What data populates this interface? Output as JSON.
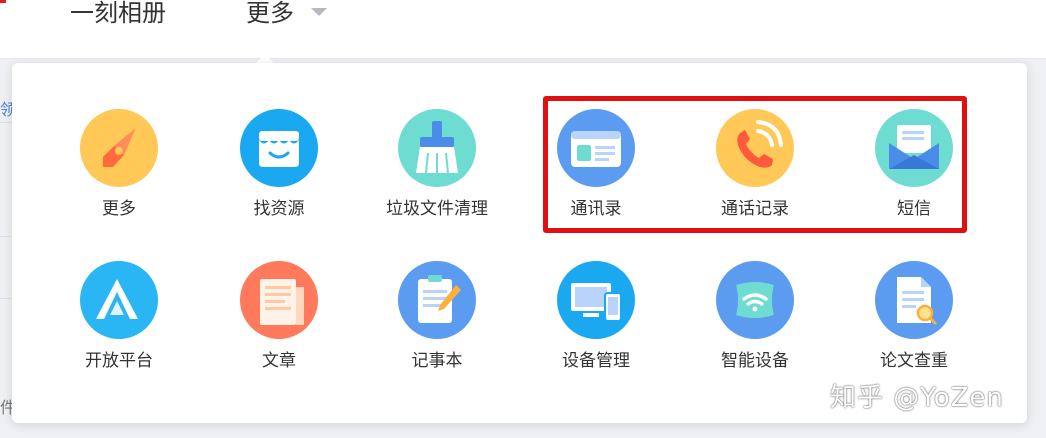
{
  "nav": {
    "album_label": "一刻相册",
    "more_label": "更多"
  },
  "background": {
    "fragment_top": "领",
    "fragment_bottom": "件"
  },
  "apps": [
    {
      "id": "more",
      "label": "更多",
      "icon": "compass-icon",
      "color": "#ffc857"
    },
    {
      "id": "find-resources",
      "label": "找资源",
      "icon": "shop-icon",
      "color": "#1aa8f0"
    },
    {
      "id": "junk-cleanup",
      "label": "垃圾文件清理",
      "icon": "broom-icon",
      "color": "#6fdcd2"
    },
    {
      "id": "contacts",
      "label": "通讯录",
      "icon": "contact-card-icon",
      "color": "#5b9bf0"
    },
    {
      "id": "call-log",
      "label": "通话记录",
      "icon": "phone-icon",
      "color": "#ffc857"
    },
    {
      "id": "sms",
      "label": "短信",
      "icon": "envelope-icon",
      "color": "#6fdcd2"
    },
    {
      "id": "open-platform",
      "label": "开放平台",
      "icon": "platform-logo-icon",
      "color": "#2ab6f5"
    },
    {
      "id": "articles",
      "label": "文章",
      "icon": "document-icon",
      "color": "#ff7a5c"
    },
    {
      "id": "notepad",
      "label": "记事本",
      "icon": "notepad-icon",
      "color": "#5b9bf0"
    },
    {
      "id": "device-management",
      "label": "设备管理",
      "icon": "devices-icon",
      "color": "#1aa8f0"
    },
    {
      "id": "smart-devices",
      "label": "智能设备",
      "icon": "wifi-device-icon",
      "color": "#5b9bf0"
    },
    {
      "id": "paper-check",
      "label": "论文查重",
      "icon": "paper-search-icon",
      "color": "#5b9bf0"
    }
  ],
  "watermark": "知乎 @YoZen",
  "colors": {
    "highlight": "#e01010"
  }
}
